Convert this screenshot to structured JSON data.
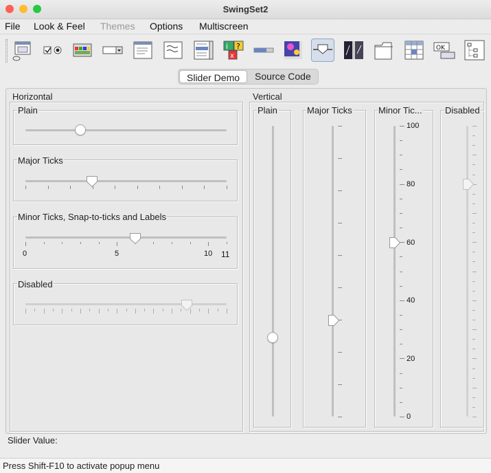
{
  "window": {
    "title": "SwingSet2",
    "traffic_lights": {
      "close": "#ff5f57",
      "minimize": "#febc2e",
      "zoom": "#28c840"
    }
  },
  "menu": {
    "items": [
      {
        "label": "File",
        "enabled": true
      },
      {
        "label": "Look & Feel",
        "enabled": true
      },
      {
        "label": "Themes",
        "enabled": false
      },
      {
        "label": "Options",
        "enabled": true
      },
      {
        "label": "Multiscreen",
        "enabled": true
      }
    ]
  },
  "toolbar": {
    "buttons": [
      {
        "icon": "internal-frame-icon"
      },
      {
        "icon": "checkbox-radio-icon"
      },
      {
        "icon": "color-chooser-icon"
      },
      {
        "icon": "combobox-icon"
      },
      {
        "icon": "file-chooser-icon"
      },
      {
        "icon": "editor-pane-icon"
      },
      {
        "icon": "list-icon"
      },
      {
        "icon": "option-pane-icon"
      },
      {
        "icon": "progress-bar-icon"
      },
      {
        "icon": "scroll-pane-icon"
      },
      {
        "icon": "slider-icon",
        "selected": true
      },
      {
        "icon": "split-pane-icon"
      },
      {
        "icon": "tabbed-pane-icon"
      },
      {
        "icon": "table-icon"
      },
      {
        "icon": "tooltip-icon",
        "text": "OK"
      },
      {
        "icon": "tree-icon"
      }
    ]
  },
  "tabs": {
    "slider_demo": "Slider Demo",
    "source_code": "Source Code",
    "active": "slider_demo"
  },
  "horizontal": {
    "title": "Horizontal",
    "plain": {
      "label": "Plain",
      "value": 0.28
    },
    "major_ticks": {
      "label": "Major Ticks",
      "value": 0.32
    },
    "minor_ticks": {
      "label": "Minor Ticks, Snap-to-ticks and Labels",
      "tick_labels": [
        "0",
        "5",
        "10",
        "11"
      ],
      "value": 6,
      "max": 11
    },
    "disabled": {
      "label": "Disabled",
      "value": 0.8
    }
  },
  "vertical": {
    "title": "Vertical",
    "plain": {
      "label": "Plain",
      "value": 0.27
    },
    "major_ticks": {
      "label": "Major Ticks",
      "value": 0.33
    },
    "minor_ticks": {
      "label": "Minor Tic...",
      "tick_labels": [
        "100",
        "80",
        "60",
        "40",
        "20",
        "0"
      ],
      "value": 60
    },
    "disabled": {
      "label": "Disabled",
      "value": 0.8
    }
  },
  "slider_value": {
    "label": "Slider Value:"
  },
  "status": {
    "text": "Press Shift-F10 to activate popup menu"
  }
}
